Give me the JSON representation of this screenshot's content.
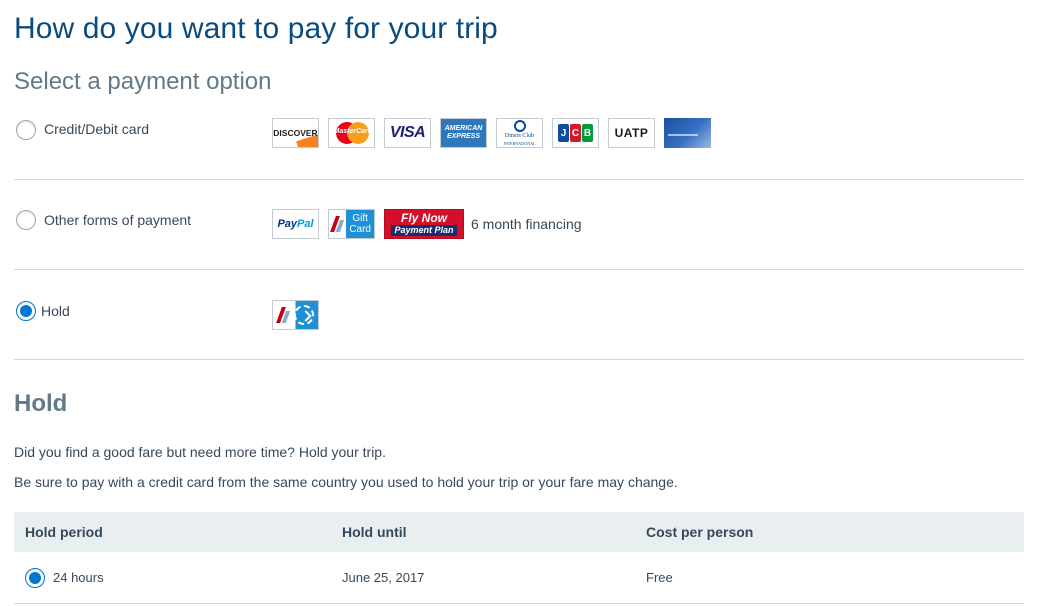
{
  "page": {
    "title": "How do you want to pay for your trip",
    "section_title": "Select a payment option"
  },
  "options": {
    "credit": {
      "label": "Credit/Debit card",
      "selected": false
    },
    "other": {
      "label": "Other forms of payment",
      "selected": false,
      "financing_text": "6 month financing"
    },
    "hold": {
      "label": "Hold",
      "selected": true
    }
  },
  "card_logos": {
    "discover": "DISCOVER",
    "mastercard": "MasterCard",
    "visa": "VISA",
    "amex_1": "AMERICAN",
    "amex_2": "EXPRESS",
    "diners_1": "Diners Club",
    "diners_2": "INTERNATIONAL",
    "jcb_1": "J",
    "jcb_2": "C",
    "jcb_3": "B",
    "uatp": "UATP"
  },
  "other_logos": {
    "paypal_1": "Pay",
    "paypal_2": "Pal",
    "gift_1": "Gift",
    "gift_2": "Card",
    "flynow_1": "Fly Now",
    "flynow_2": "Payment Plan"
  },
  "hold_section": {
    "title": "Hold",
    "line1": "Did you find a good fare but need more time? Hold your trip.",
    "line2": "Be sure to pay with a credit card from the same country you used to hold your trip or your fare may change."
  },
  "hold_table": {
    "headers": [
      "Hold period",
      "Hold until",
      "Cost per person"
    ],
    "rows": [
      {
        "period": "24 hours",
        "until": "June 25, 2017",
        "cost": "Free",
        "selected": true
      }
    ]
  },
  "colors": {
    "title": "#0b4a7d",
    "accent": "#0078d2",
    "text": "#36495a",
    "table_header_bg": "#e9eef1"
  }
}
